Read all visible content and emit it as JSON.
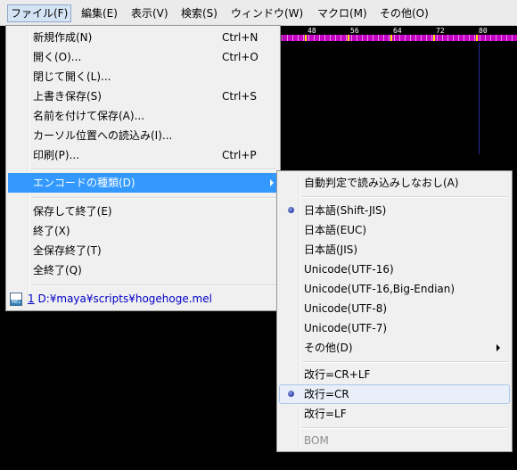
{
  "menubar": {
    "items": [
      {
        "label": "ファイル(F)"
      },
      {
        "label": "編集(E)"
      },
      {
        "label": "表示(V)"
      },
      {
        "label": "検索(S)"
      },
      {
        "label": "ウィンドウ(W)"
      },
      {
        "label": "マクロ(M)"
      },
      {
        "label": "その他(O)"
      }
    ]
  },
  "ruler": {
    "labels": [
      "48",
      "56",
      "64",
      "72",
      "80"
    ]
  },
  "file_menu": {
    "items": [
      {
        "label": "新規作成(N)",
        "shortcut": "Ctrl+N"
      },
      {
        "label": "開く(O)...",
        "shortcut": "Ctrl+O"
      },
      {
        "label": "閉じて開く(L)..."
      },
      {
        "label": "上書き保存(S)",
        "shortcut": "Ctrl+S"
      },
      {
        "label": "名前を付けて保存(A)..."
      },
      {
        "label": "カーソル位置への読込み(I)..."
      },
      {
        "label": "印刷(P)...",
        "shortcut": "Ctrl+P"
      },
      {
        "label": "エンコードの種類(D)"
      },
      {
        "label": "保存して終了(E)"
      },
      {
        "label": "終了(X)"
      },
      {
        "label": "全保存終了(T)"
      },
      {
        "label": "全終了(Q)"
      }
    ],
    "recent": {
      "number": "1",
      "path": " D:¥maya¥scripts¥hogehoge.mel",
      "icon_text": "MEL"
    }
  },
  "encoding_menu": {
    "items": [
      {
        "label": "自動判定で読み込みしなおし(A)"
      },
      {
        "label": "日本語(Shift-JIS)",
        "checked": true
      },
      {
        "label": "日本語(EUC)"
      },
      {
        "label": "日本語(JIS)"
      },
      {
        "label": "Unicode(UTF-16)"
      },
      {
        "label": "Unicode(UTF-16,Big-Endian)"
      },
      {
        "label": "Unicode(UTF-8)"
      },
      {
        "label": "Unicode(UTF-7)"
      },
      {
        "label": "その他(D)"
      },
      {
        "label": "改行=CR+LF"
      },
      {
        "label": "改行=CR",
        "checked": true
      },
      {
        "label": "改行=LF"
      },
      {
        "label": "BOM",
        "disabled": true
      }
    ]
  }
}
